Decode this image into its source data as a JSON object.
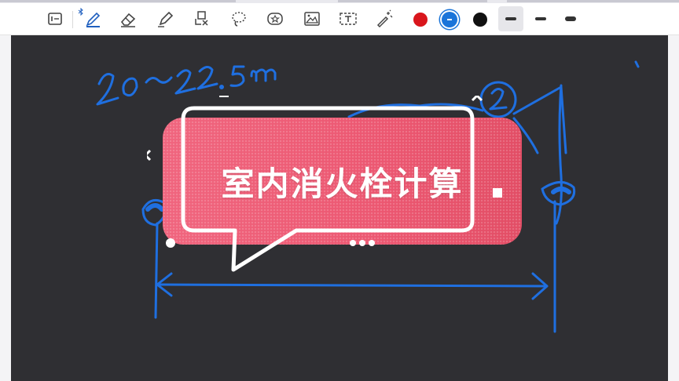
{
  "toolbar": {
    "tools": [
      {
        "name": "page-view",
        "icon": "page-view-icon"
      },
      {
        "name": "pen",
        "icon": "pen-icon",
        "bluetooth": "bluetooth-icon"
      },
      {
        "name": "eraser",
        "icon": "eraser-icon"
      },
      {
        "name": "highlighter",
        "icon": "highlighter-icon"
      },
      {
        "name": "shape",
        "icon": "shape-recognition-icon"
      },
      {
        "name": "lasso",
        "icon": "lasso-icon"
      },
      {
        "name": "sticker",
        "icon": "sticker-icon"
      },
      {
        "name": "image",
        "icon": "image-icon"
      },
      {
        "name": "text",
        "icon": "text-box-icon"
      },
      {
        "name": "laser",
        "icon": "laser-pointer-icon"
      }
    ],
    "colors": [
      {
        "name": "red",
        "hex": "#d9161c"
      },
      {
        "name": "blue",
        "hex": "#1a74d9",
        "selected": true
      },
      {
        "name": "black",
        "hex": "#111111"
      }
    ],
    "stroke_sizes": [
      "thick",
      "medium",
      "thin"
    ],
    "selected_stroke": "thick"
  },
  "canvas": {
    "background": "#2f2f33",
    "ink_color": "#1f6fe0",
    "handwriting_note": "20~22.5m"
  },
  "overlay": {
    "title": "室内消火栓计算",
    "bubble_color": "#ee5a73"
  }
}
